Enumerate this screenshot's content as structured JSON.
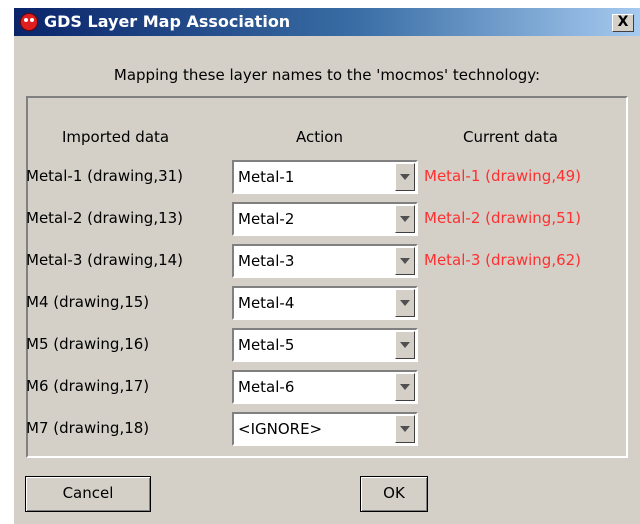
{
  "window": {
    "title": "GDS Layer Map Association",
    "close_label": "X"
  },
  "instruction": "Mapping these layer names to the 'mocmos' technology:",
  "columns": {
    "imported": "Imported data",
    "action": "Action",
    "current": "Current data"
  },
  "rows": [
    {
      "imported": "Metal-1 (drawing,31)",
      "action": "Metal-1",
      "current": "Metal-1 (drawing,49)"
    },
    {
      "imported": "Metal-2 (drawing,13)",
      "action": "Metal-2",
      "current": "Metal-2 (drawing,51)"
    },
    {
      "imported": "Metal-3 (drawing,14)",
      "action": "Metal-3",
      "current": "Metal-3 (drawing,62)"
    },
    {
      "imported": "M4 (drawing,15)",
      "action": "Metal-4",
      "current": ""
    },
    {
      "imported": "M5 (drawing,16)",
      "action": "Metal-5",
      "current": ""
    },
    {
      "imported": "M6 (drawing,17)",
      "action": "Metal-6",
      "current": ""
    },
    {
      "imported": "M7 (drawing,18)",
      "action": "<IGNORE>",
      "current": ""
    }
  ],
  "buttons": {
    "cancel": "Cancel",
    "ok": "OK"
  },
  "colors": {
    "title_bar": "#0a246a",
    "dialog_bg": "#d4d0c8",
    "current_data_text": "#ff3030"
  },
  "icons": {
    "app": "electric-app-icon",
    "close": "close-icon",
    "dropdown": "chevron-down-icon"
  }
}
